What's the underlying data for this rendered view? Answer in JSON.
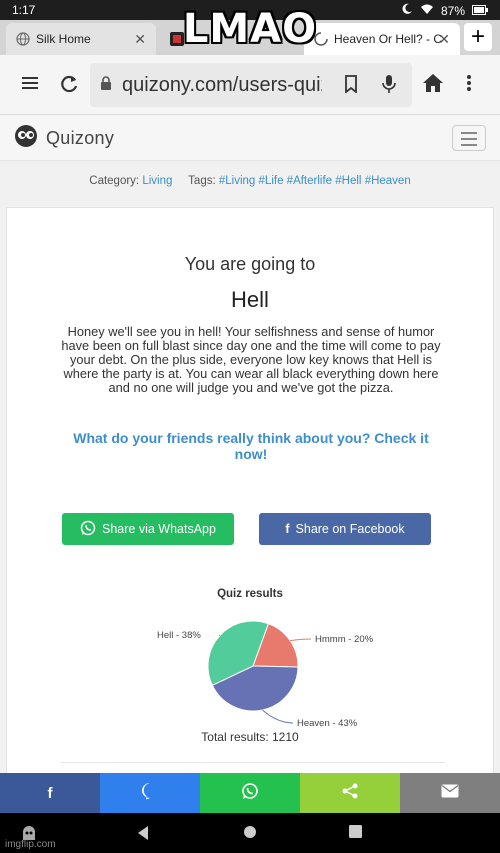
{
  "meme": {
    "caption": "LMAO"
  },
  "status_bar": {
    "time": "1:17",
    "battery": "87%"
  },
  "tabs": [
    {
      "title": "Silk Home"
    },
    {
      "title": "Im"
    },
    {
      "title": "Heaven Or Hell? - C"
    }
  ],
  "address_bar": {
    "url": "quizony.com/users-quizze"
  },
  "site": {
    "logo_text": "Quizony",
    "category_label": "Category:",
    "category": "Living",
    "tags_label": "Tags:",
    "tags": [
      "#Living",
      "#Life",
      "#Afterlife",
      "#Hell",
      "#Heaven"
    ]
  },
  "result_card": {
    "heading": "You are going to",
    "result": "Hell",
    "description": "Honey we'll see you in hell! Your selfishness and sense of humor have been on full blast since day one and the time will come to pay your debt. On the plus side, everyone low key knows that Hell is where the party is at. You can wear all black everything down here and no one will judge you and we've got the pizza.",
    "friends_cta": "What do your friends really think about you? Check it now!",
    "share_whatsapp": "Share via WhatsApp",
    "share_facebook": "Share on Facebook"
  },
  "chart_data": {
    "type": "pie",
    "title": "Quiz results",
    "slices": [
      {
        "label": "Hell - 38%",
        "value": 38,
        "color": "#52cc9a"
      },
      {
        "label": "Hmmm - 20%",
        "value": 20,
        "color": "#e8796d"
      },
      {
        "label": "Heaven - 43%",
        "value": 43,
        "color": "#6672b4"
      }
    ],
    "total_text": "Total results: 1210"
  },
  "colors": {
    "facebook": "#3b5998",
    "messenger": "#2f80ed",
    "whatsapp": "#25c14f",
    "sharethis": "#95d03a",
    "email": "#7f7f7f",
    "link": "#3a8fc8"
  },
  "watermark": "imgflip.com"
}
